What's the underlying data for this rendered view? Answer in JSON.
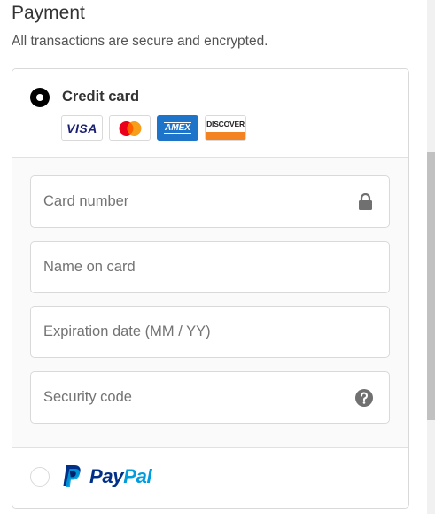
{
  "section": {
    "title": "Payment",
    "subtitle": "All transactions are secure and encrypted."
  },
  "credit_card": {
    "label": "Credit card",
    "selected": true,
    "brands": [
      {
        "name": "VISA",
        "icon": "visa-logo-icon",
        "color": "#1a1f71"
      },
      {
        "name": "Mastercard",
        "icon": "mastercard-logo-icon",
        "color": "#eb001b"
      },
      {
        "name": "AMEX",
        "icon": "amex-logo-icon",
        "color": "#1e74c8"
      },
      {
        "name": "DISCOVER",
        "icon": "discover-logo-icon",
        "color": "#f58220"
      }
    ]
  },
  "fields": {
    "card_number": {
      "placeholder": "Card number",
      "value": "",
      "icon": "lock-icon"
    },
    "name_on_card": {
      "placeholder": "Name on card",
      "value": ""
    },
    "expiration": {
      "placeholder": "Expiration date (MM / YY)",
      "value": ""
    },
    "security_code": {
      "placeholder": "Security code",
      "value": "",
      "icon": "question-circle-icon"
    }
  },
  "paypal": {
    "selected": false,
    "logo_part1": "Pay",
    "logo_part2": "Pal",
    "colors": {
      "dark": "#003087",
      "light": "#009cde"
    }
  }
}
